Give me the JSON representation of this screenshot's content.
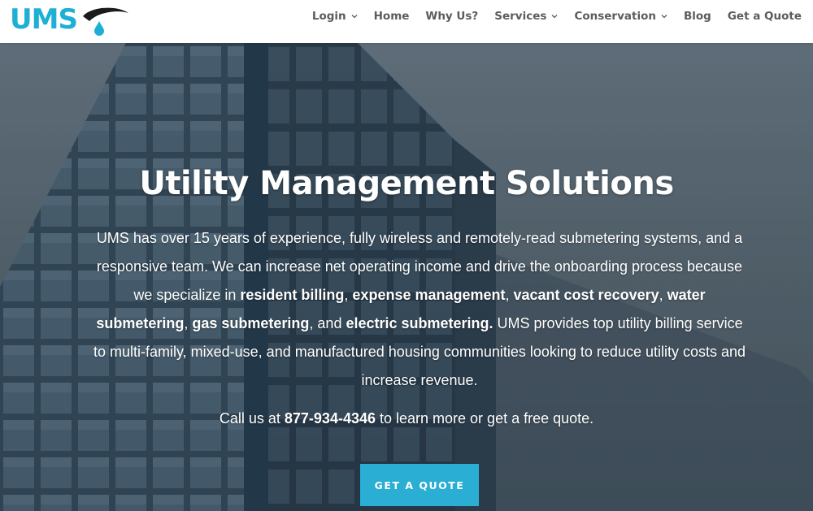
{
  "brand": {
    "logo_text": "UMS",
    "accent": "#1eafd5",
    "swoosh": "#1b1b1b"
  },
  "nav": [
    {
      "label": "Login",
      "dropdown": true
    },
    {
      "label": "Home",
      "dropdown": false
    },
    {
      "label": "Why Us?",
      "dropdown": false
    },
    {
      "label": "Services",
      "dropdown": true
    },
    {
      "label": "Conservation",
      "dropdown": true
    },
    {
      "label": "Blog",
      "dropdown": false
    },
    {
      "label": "Get a Quote",
      "dropdown": false
    }
  ],
  "hero": {
    "title": "Utility Management Solutions",
    "p1": "UMS has over 15 years of experience, fully wireless and remotely-read submetering systems, and a responsive team. We can increase net operating income and drive the onboarding process because we specialize in ",
    "b1": "resident billing",
    "s1": ", ",
    "b2": "expense management",
    "s2": ", ",
    "b3": "vacant cost recovery",
    "s3": ", ",
    "b4": "water submetering",
    "s4": ", ",
    "b5": "gas submetering",
    "s5": ", and ",
    "b6": "electric submetering.",
    "p2": " UMS provides top utility billing service to multi-family, mixed-use, and manufactured housing communities looking to reduce utility costs and increase revenue.",
    "call_prefix": "Call us at ",
    "phone": "877-934-4346",
    "call_suffix": " to learn more or get a free quote.",
    "cta_label": "GET A QUOTE"
  },
  "colors": {
    "cta_bg": "#2aaed3",
    "nav_text": "#5c5c5c"
  }
}
